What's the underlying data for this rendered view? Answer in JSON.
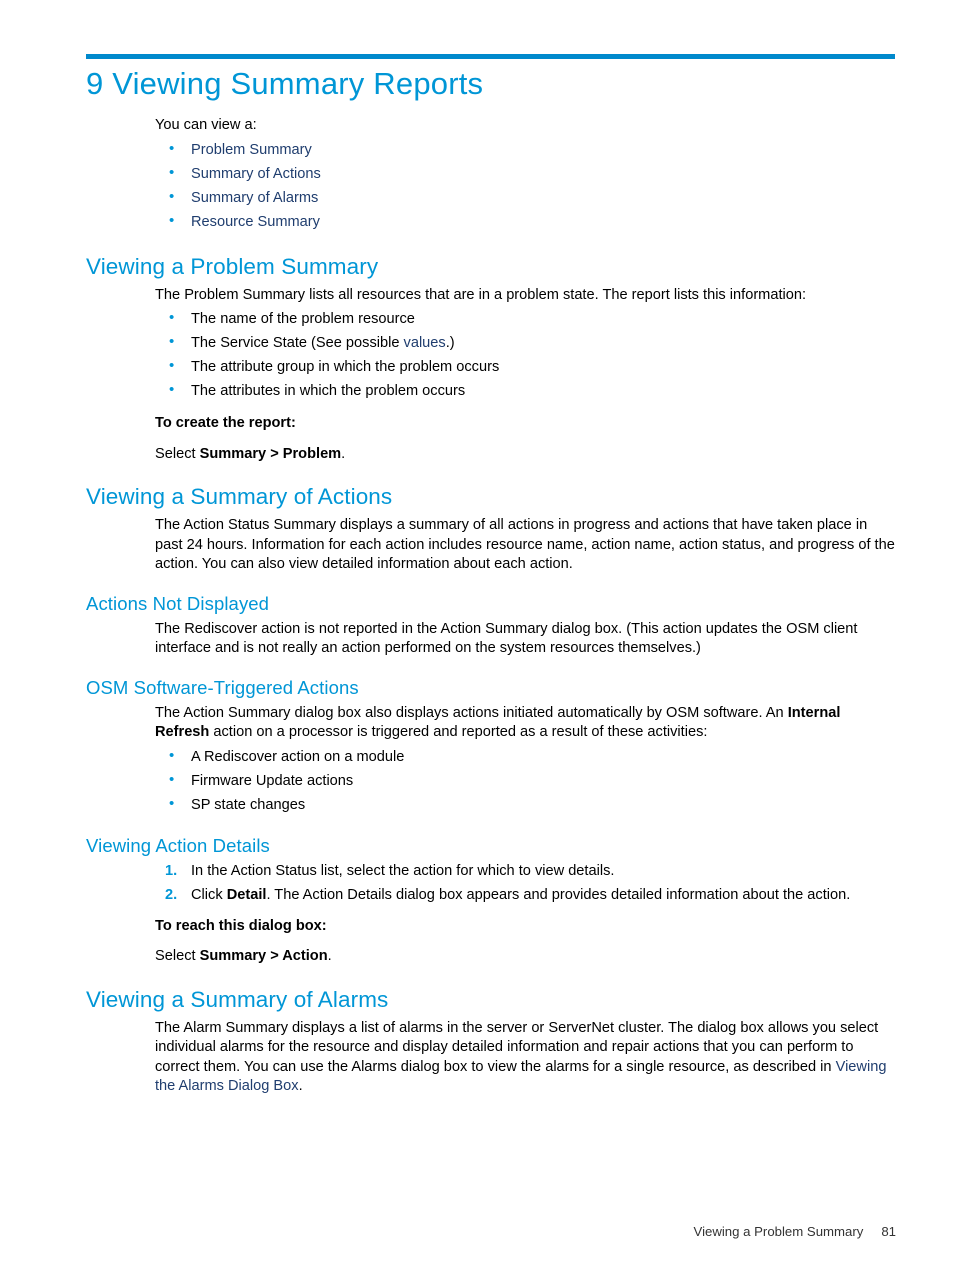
{
  "page": {
    "chapter_title": "9 Viewing Summary Reports",
    "accent_color": "#0096D6",
    "xref_color": "#1F3D6E",
    "footer": {
      "section": "Viewing a Problem Summary",
      "page_number": "81"
    }
  },
  "intro": {
    "lead": "You can view a:",
    "items": [
      "Problem Summary",
      "Summary of Actions",
      "Summary of Alarms",
      "Resource Summary"
    ]
  },
  "problem_summary": {
    "heading": "Viewing a Problem Summary",
    "paragraph": "The Problem Summary lists all resources that are in a problem state. The report lists this information:",
    "items": [
      "The name of the problem resource",
      "The Service State (See possible values.)",
      "The attribute group in which the problem occurs",
      "The attributes in which the problem occurs"
    ],
    "item2_prefix": "The Service State (See possible ",
    "item2_link": "values",
    "item2_suffix": ".)",
    "to_create_label": "To create the report:",
    "select_prefix": "Select ",
    "select_bold": "Summary > Problem",
    "select_suffix": "."
  },
  "summary_actions": {
    "heading": "Viewing a Summary of Actions",
    "paragraph": "The Action Status Summary displays a summary of all actions in progress and actions that have taken place in past 24 hours. Information for each action includes resource name, action name, action status, and progress of the action. You can also view detailed information about each action."
  },
  "actions_not_displayed": {
    "heading": "Actions Not Displayed",
    "paragraph": "The Rediscover action is not reported in the Action Summary dialog box. (This action updates the OSM client interface and is not really an action performed on the system resources themselves.)"
  },
  "osm_software_triggered": {
    "heading": "OSM Software-Triggered Actions",
    "paragraph_part1": "The Action Summary dialog box also displays actions initiated automatically by OSM software. An ",
    "paragraph_bold": "Internal Refresh",
    "paragraph_part2": " action on a processor is triggered and reported as a result of these activities:",
    "items": [
      "A Rediscover action on a module",
      "Firmware Update actions",
      "SP state changes"
    ]
  },
  "viewing_action_details": {
    "heading": "Viewing Action Details",
    "steps": [
      {
        "marker": "1.",
        "text": "In the Action Status list, select the action for which to view details."
      },
      {
        "marker": "2.",
        "prefix": "Click ",
        "bold": "Detail",
        "suffix": ". The Action Details dialog box appears and provides detailed information about the action."
      }
    ],
    "to_reach_label": "To reach this dialog box:",
    "select_prefix": "Select ",
    "select_bold": "Summary > Action",
    "select_suffix": "."
  },
  "summary_alarms": {
    "heading": "Viewing a Summary of Alarms",
    "paragraph_part1": "The Alarm Summary displays a list of alarms in the server or ServerNet cluster. The dialog box allows you select individual alarms for the resource and display detailed information and repair actions that you can perform to correct them. You can use the Alarms dialog box to view the alarms for a single resource, as described in ",
    "paragraph_link": "Viewing the Alarms Dialog Box",
    "paragraph_part2": "."
  }
}
